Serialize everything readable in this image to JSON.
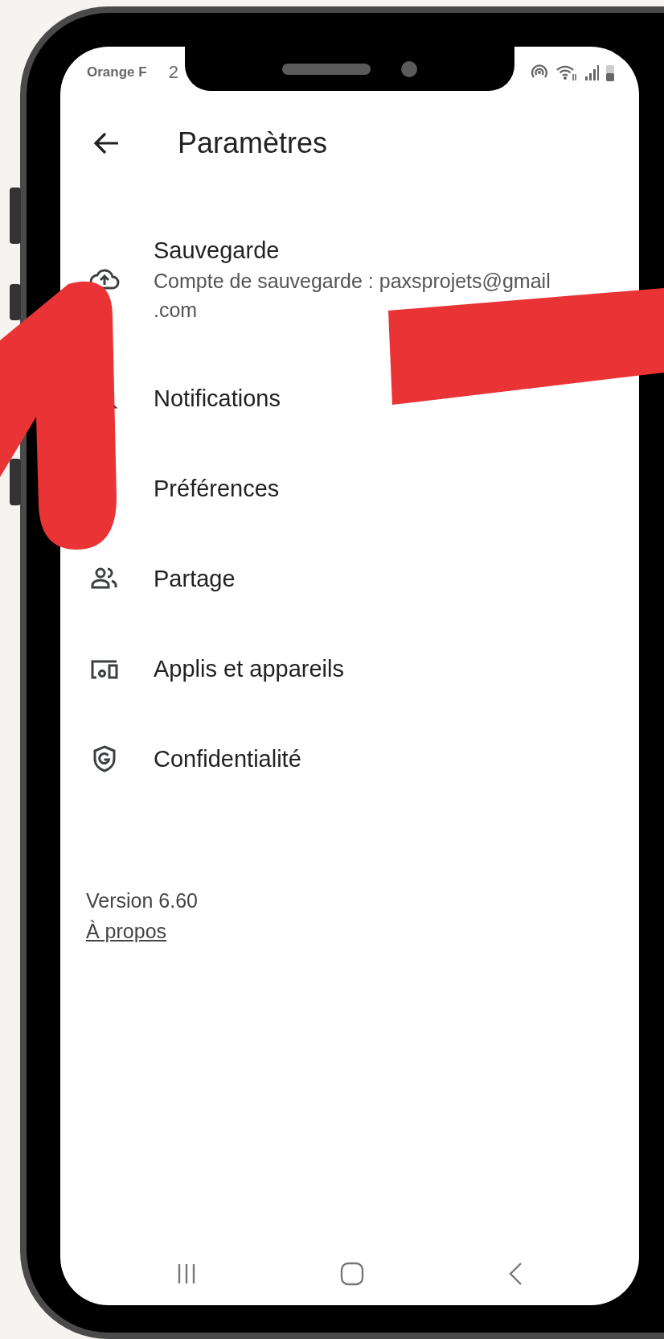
{
  "status_bar": {
    "carrier": "Orange F",
    "time": "2"
  },
  "header": {
    "title": "Paramètres"
  },
  "settings": [
    {
      "title": "Sauvegarde",
      "subtitle": "Compte de sauvegarde : paxsprojets@gmail .com"
    },
    {
      "title": "Notifications"
    },
    {
      "title": "Préférences"
    },
    {
      "title": "Partage"
    },
    {
      "title": "Applis et appareils"
    },
    {
      "title": "Confidentialité"
    }
  ],
  "footer": {
    "version": "Version 6.60",
    "about_link": "À propos"
  }
}
